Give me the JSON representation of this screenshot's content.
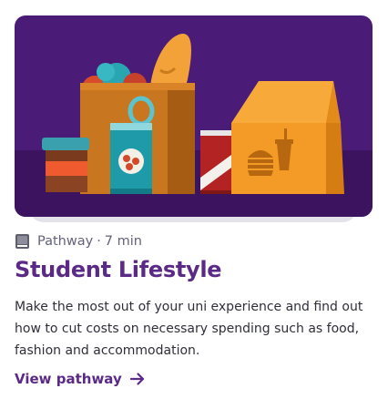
{
  "card": {
    "type_label": "Pathway",
    "separator": "·",
    "duration": "7 min",
    "title": "Student Lifestyle",
    "description": "Make the most out of your uni experience and find out how to cut costs on necessary spending such as food, fashion and accommodation.",
    "link_label": "View pathway",
    "hero_image": "groceries-and-takeaway-illustration"
  },
  "icons": {
    "type": "book-icon",
    "link": "arrow-right-icon"
  },
  "colors": {
    "brand_purple": "#5b2a86",
    "hero_background": "#4a1c78",
    "meta_text": "#63627a",
    "body_text": "#2f2f3a"
  }
}
